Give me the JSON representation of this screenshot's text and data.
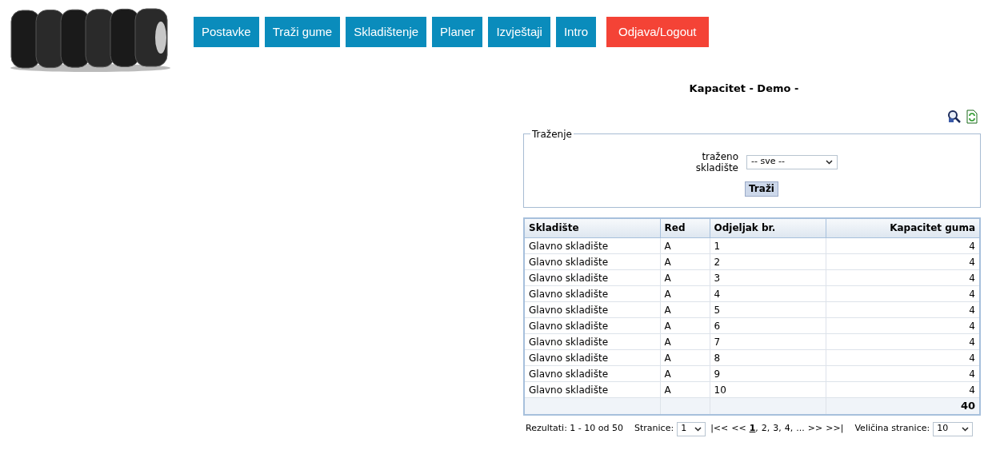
{
  "nav": [
    {
      "label": "Postavke",
      "kind": "normal"
    },
    {
      "label": "Traži gume",
      "kind": "normal"
    },
    {
      "label": "Skladištenje",
      "kind": "normal"
    },
    {
      "label": "Planer",
      "kind": "normal"
    },
    {
      "label": "Izvještaji",
      "kind": "normal"
    },
    {
      "label": "Intro",
      "kind": "normal"
    },
    {
      "label": "Odjava/Logout",
      "kind": "logout"
    }
  ],
  "title": "Kapacitet - Demo -",
  "search": {
    "legend": "Traženje",
    "field_label": "traženo skladište",
    "select_value": "-- sve --",
    "button": "Traži"
  },
  "table": {
    "columns": [
      "Skladište",
      "Red",
      "Odjeljak br.",
      "Kapacitet guma"
    ],
    "rows": [
      [
        "Glavno skladište",
        "A",
        "1",
        "4"
      ],
      [
        "Glavno skladište",
        "A",
        "2",
        "4"
      ],
      [
        "Glavno skladište",
        "A",
        "3",
        "4"
      ],
      [
        "Glavno skladište",
        "A",
        "4",
        "4"
      ],
      [
        "Glavno skladište",
        "A",
        "5",
        "4"
      ],
      [
        "Glavno skladište",
        "A",
        "6",
        "4"
      ],
      [
        "Glavno skladište",
        "A",
        "7",
        "4"
      ],
      [
        "Glavno skladište",
        "A",
        "8",
        "4"
      ],
      [
        "Glavno skladište",
        "A",
        "9",
        "4"
      ],
      [
        "Glavno skladište",
        "A",
        "10",
        "4"
      ]
    ],
    "total": "40"
  },
  "pager": {
    "results": "Rezultati: 1 - 10 od 50",
    "pages_label": "Stranice:",
    "page_select": "1",
    "first": "|<<",
    "prev": "<<",
    "pages": [
      {
        "label": "1",
        "selected": true
      },
      {
        "label": "2",
        "selected": false
      },
      {
        "label": "3",
        "selected": false
      },
      {
        "label": "4",
        "selected": false
      },
      {
        "label": "...",
        "selected": false
      }
    ],
    "separator": ",",
    "next": ">>",
    "last": ">>|",
    "size_label": "Veličina stranice:",
    "size_select": "10"
  }
}
